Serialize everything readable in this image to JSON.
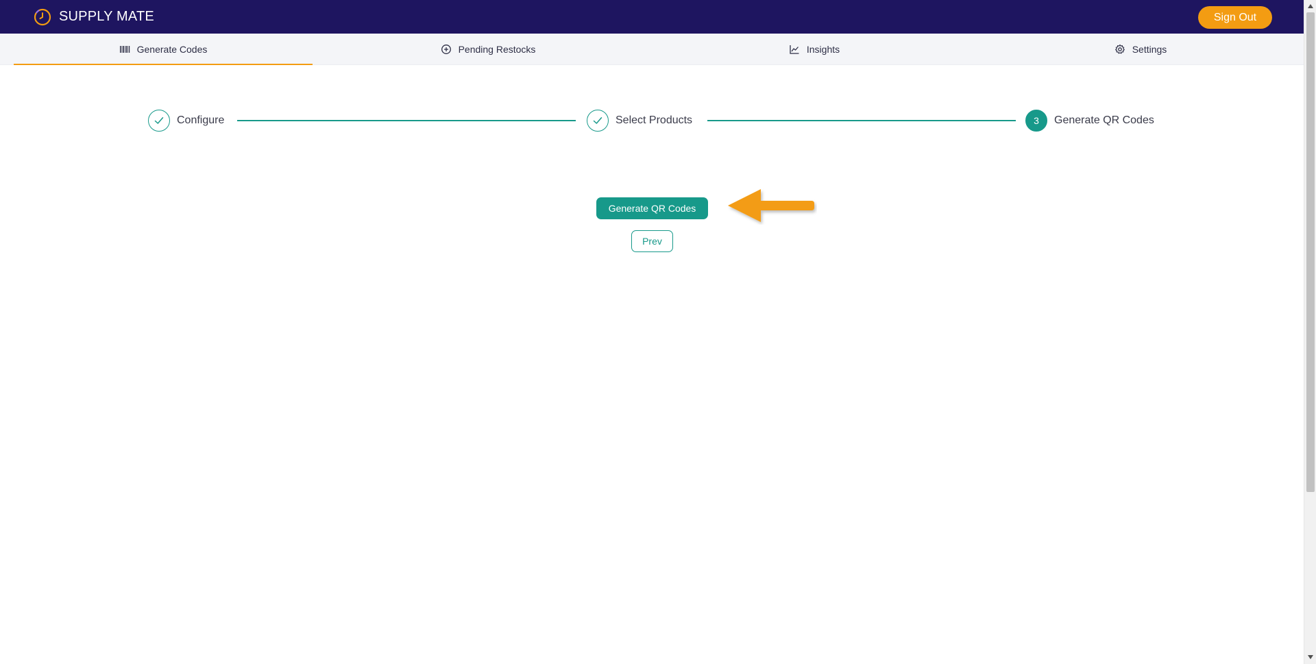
{
  "header": {
    "app_name": "SUPPLY MATE",
    "logo_icon": "clock-logo-icon",
    "sign_out_label": "Sign Out",
    "brand_color": "#1e1560",
    "accent_color": "#f39c12"
  },
  "nav": {
    "tabs": [
      {
        "label": "Generate Codes",
        "icon": "barcode-icon",
        "active": true
      },
      {
        "label": "Pending Restocks",
        "icon": "plus-circle-icon",
        "active": false
      },
      {
        "label": "Insights",
        "icon": "line-chart-icon",
        "active": false
      },
      {
        "label": "Settings",
        "icon": "gear-icon",
        "active": false
      }
    ]
  },
  "stepper": {
    "steps": [
      {
        "label": "Configure",
        "status": "complete"
      },
      {
        "label": "Select Products",
        "status": "complete"
      },
      {
        "label": "Generate QR Codes",
        "status": "current",
        "number": "3"
      }
    ],
    "color": "#17998a"
  },
  "actions": {
    "generate_label": "Generate QR Codes",
    "prev_label": "Prev"
  },
  "annotation": {
    "icon": "arrow-left-icon",
    "color": "#f39c12"
  }
}
